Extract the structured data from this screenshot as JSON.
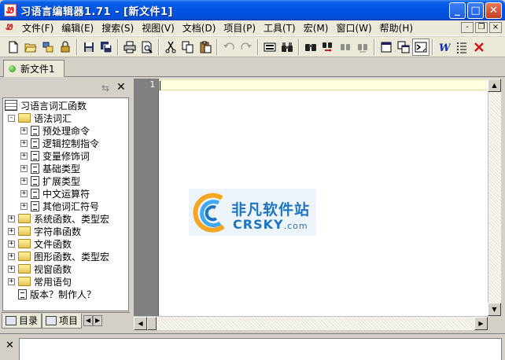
{
  "window": {
    "title": "习语言编辑器1.71 - [新文件1]",
    "app_icon_glyph": "Ꮺ",
    "buttons": {
      "minimize": "_",
      "maximize": "□",
      "close": "✕"
    }
  },
  "menu": {
    "items": [
      "文件(F)",
      "编辑(E)",
      "搜索(S)",
      "视图(V)",
      "文档(D)",
      "项目(P)",
      "工具(T)",
      "宏(M)",
      "窗口(W)",
      "帮助(H)"
    ],
    "mdi_buttons": [
      "-",
      "❐",
      "×"
    ]
  },
  "toolbar": {
    "icons": [
      "new-file",
      "open-folder",
      "open-project",
      "lock",
      "save",
      "save-all",
      "print",
      "print-preview",
      "cut",
      "copy",
      "paste",
      "undo",
      "redo",
      "macro-record",
      "find-binoculars",
      "find",
      "replace",
      "find-in-files",
      "find-next",
      "view-single",
      "view-multi",
      "terminal",
      "word-wrap",
      "line-numbers",
      "close-x"
    ]
  },
  "document_tab": {
    "label": "新文件1"
  },
  "left_panel": {
    "tree": {
      "root": "习语言词汇函数",
      "items": [
        {
          "label": "语法词汇",
          "level": 1,
          "type": "folder",
          "expander": "-"
        },
        {
          "label": "预处理命令",
          "level": 2,
          "type": "doc",
          "expander": "+"
        },
        {
          "label": "逻辑控制指令",
          "level": 2,
          "type": "doc",
          "expander": "+"
        },
        {
          "label": "变量修饰词",
          "level": 2,
          "type": "doc",
          "expander": "+"
        },
        {
          "label": "基础类型",
          "level": 2,
          "type": "doc",
          "expander": "+"
        },
        {
          "label": "扩展类型",
          "level": 2,
          "type": "doc",
          "expander": "+"
        },
        {
          "label": "中文运算符",
          "level": 2,
          "type": "doc",
          "expander": "+"
        },
        {
          "label": "其他词汇符号",
          "level": 2,
          "type": "doc",
          "expander": "+"
        },
        {
          "label": "系统函数、类型宏",
          "level": 1,
          "type": "folder",
          "expander": "+"
        },
        {
          "label": "字符串函数",
          "level": 1,
          "type": "folder",
          "expander": "+"
        },
        {
          "label": "文件函数",
          "level": 1,
          "type": "folder",
          "expander": "+"
        },
        {
          "label": "图形函数、类型宏",
          "level": 1,
          "type": "folder",
          "expander": "+"
        },
        {
          "label": "视窗函数",
          "level": 1,
          "type": "folder",
          "expander": "+"
        },
        {
          "label": "常用语句",
          "level": 1,
          "type": "folder",
          "expander": "+"
        },
        {
          "label": "版本？制作人？",
          "level": 1,
          "type": "doc",
          "expander": ""
        }
      ]
    },
    "tabs": [
      "目录",
      "项目"
    ],
    "pin_glyph": "⇆",
    "close_glyph": "✕"
  },
  "editor": {
    "line_number": "1",
    "current_line_color": "#FFFFE0",
    "gutter_color": "#808080"
  },
  "watermark": {
    "text_cn": "非凡软件站",
    "text_en": "CRSKY",
    "text_com": ".com"
  },
  "output": {
    "close_glyph": "✕"
  }
}
